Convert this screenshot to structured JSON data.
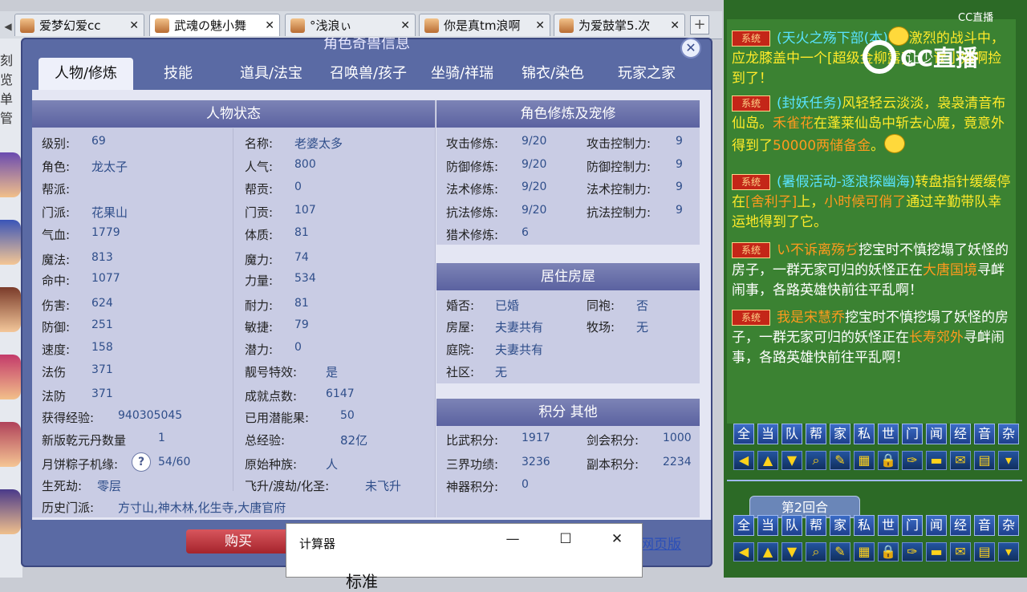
{
  "browser": {
    "tabs": [
      {
        "label": "爱梦幻爱cc",
        "active": false
      },
      {
        "label": "武魂の魅小舞",
        "active": true
      },
      {
        "label": "°浅浪ぃ",
        "active": false
      },
      {
        "label": "你是真tm浪啊",
        "active": false
      },
      {
        "label": "为爱鼓掌5.次",
        "active": false
      }
    ],
    "new_tab": "+",
    "close_glyph": "✕",
    "left_strip_text": [
      "刻览",
      "单管"
    ]
  },
  "game_window": {
    "title": "角色奇兽信息",
    "close": "✕",
    "tabs": [
      "人物/修炼",
      "技能",
      "道具/法宝",
      "召唤兽/孩子",
      "坐骑/祥瑞",
      "锦衣/染色",
      "玩家之家"
    ],
    "active_tab": "人物/修炼",
    "status": {
      "header": "人物状态",
      "left": [
        {
          "label": "级别:",
          "value": "69"
        },
        {
          "label": "角色:",
          "value": "龙太子"
        },
        {
          "label": "帮派:",
          "value": ""
        },
        {
          "label": "门派:",
          "value": "花果山"
        },
        {
          "label": "气血:",
          "value": "1779"
        },
        {
          "label": "魔法:",
          "value": "813"
        },
        {
          "label": "命中:",
          "value": "1077"
        },
        {
          "label": "伤害:",
          "value": "624"
        },
        {
          "label": "防御:",
          "value": "251"
        },
        {
          "label": "速度:",
          "value": "158"
        },
        {
          "label": "法伤",
          "value": "371"
        },
        {
          "label": "法防",
          "value": "371"
        }
      ],
      "right": [
        {
          "label": "名称:",
          "value": "老婆太多"
        },
        {
          "label": "人气:",
          "value": "800"
        },
        {
          "label": "帮贡:",
          "value": "0"
        },
        {
          "label": "门贡:",
          "value": "107"
        },
        {
          "label": "体质:",
          "value": "81"
        },
        {
          "label": "魔力:",
          "value": "74"
        },
        {
          "label": "力量:",
          "value": "534"
        },
        {
          "label": "耐力:",
          "value": "81"
        },
        {
          "label": "敏捷:",
          "value": "79"
        },
        {
          "label": "潜力:",
          "value": "0"
        },
        {
          "label": "靓号特效:",
          "value": "是"
        },
        {
          "label": "成就点数:",
          "value": "6147"
        }
      ],
      "extra_left": [
        {
          "label": "获得经验:",
          "value": "940305045"
        },
        {
          "label": "新版乾元丹数量",
          "value": "1"
        },
        {
          "label": "月饼粽子机缘:",
          "value": "54/60"
        },
        {
          "label": "生死劫:",
          "value": "零层"
        }
      ],
      "extra_right": [
        {
          "label": "已用潜能果:",
          "value": "50"
        },
        {
          "label": "总经验:",
          "value": "82亿"
        },
        {
          "label": "原始种族:",
          "value": "人"
        },
        {
          "label": "飞升/渡劫/化圣:",
          "value": "未飞升"
        }
      ],
      "history": {
        "label": "历史门派:",
        "value": "方寸山,神木林,化生寺,大唐官府"
      },
      "help_icon": "?"
    },
    "cultivation": {
      "header": "角色修炼及宠修",
      "left": [
        {
          "label": "攻击修炼:",
          "value": "9/20"
        },
        {
          "label": "防御修炼:",
          "value": "9/20"
        },
        {
          "label": "法术修炼:",
          "value": "9/20"
        },
        {
          "label": "抗法修炼:",
          "value": "9/20"
        },
        {
          "label": "猎术修炼:",
          "value": "6"
        }
      ],
      "right": [
        {
          "label": "攻击控制力:",
          "value": "9"
        },
        {
          "label": "防御控制力:",
          "value": "9"
        },
        {
          "label": "法术控制力:",
          "value": "9"
        },
        {
          "label": "抗法控制力:",
          "value": "9"
        }
      ]
    },
    "house": {
      "header": "居住房屋",
      "rows": [
        {
          "label": "婚否:",
          "value": "已婚"
        },
        {
          "label": "房屋:",
          "value": "夫妻共有"
        },
        {
          "label": "庭院:",
          "value": "夫妻共有"
        },
        {
          "label": "社区:",
          "value": "无"
        }
      ],
      "right": [
        {
          "label": "同袍:",
          "value": "否"
        },
        {
          "label": "牧场:",
          "value": "无"
        }
      ]
    },
    "points": {
      "header": "积分 其他",
      "left": [
        {
          "label": "比武积分:",
          "value": "1917"
        },
        {
          "label": "三界功绩:",
          "value": "3236"
        },
        {
          "label": "神器积分:",
          "value": "0"
        }
      ],
      "right": [
        {
          "label": "剑会积分:",
          "value": "1000"
        },
        {
          "label": "副本积分:",
          "value": "2234"
        }
      ]
    },
    "buy_button": "购买",
    "web_link": "网页版"
  },
  "calculator": {
    "title": "计算器",
    "minimize": "—",
    "maximize": "☐",
    "close": "✕",
    "mode": "标准"
  },
  "chat": {
    "watermark_logo": "CC直播",
    "watermark": "CC直播",
    "system_tag": "系统",
    "messages": [
      {
        "parts": [
          {
            "t": "(天火之殇下部(本)",
            "c": "g"
          },
          {
            "t": "激烈的战斗中，应龙膝盖中",
            "c": "y"
          },
          {
            "t": "一个",
            "c": "y"
          },
          {
            "t": "[超级金柳露]",
            "c": "y"
          },
          {
            "t": "让少",
            "c": "w"
          },
          {
            "t": "误小娟啊捡到了！",
            "c": "y"
          }
        ]
      },
      {
        "parts": [
          {
            "t": "(封妖任务)",
            "c": "g"
          },
          {
            "t": "风轻轻云淡淡，袅袅清音布仙岛。",
            "c": "y"
          },
          {
            "t": "禾雀花",
            "c": "o"
          },
          {
            "t": "在蓬莱仙岛中斩去心魔，竟意外得到了",
            "c": "y"
          },
          {
            "t": "50000两储备金",
            "c": "o"
          },
          {
            "t": "。",
            "c": "y"
          }
        ]
      },
      {
        "parts": [
          {
            "t": "(暑假活动-逐浪探幽海)",
            "c": "g"
          },
          {
            "t": "转盘指针缓缓停在",
            "c": "y"
          },
          {
            "t": "[舍利子]",
            "c": "o"
          },
          {
            "t": "上，",
            "c": "y"
          },
          {
            "t": "小时候可俏了",
            "c": "o"
          },
          {
            "t": "通过辛勤带队幸运地得到了它。",
            "c": "y"
          }
        ]
      },
      {
        "parts": [
          {
            "t": "い不诉离殇ぢ",
            "c": "o"
          },
          {
            "t": "挖宝时不慎挖塌了妖怪的房子，一群无家可归的妖怪正在",
            "c": "w"
          },
          {
            "t": "大唐国境",
            "c": "o"
          },
          {
            "t": "寻衅闹事，各路英雄快前往平乱啊！",
            "c": "w"
          }
        ]
      },
      {
        "parts": [
          {
            "t": "我是宋慧乔",
            "c": "o"
          },
          {
            "t": "挖宝时不慎挖塌了妖怪的房子，一群无家可归的妖怪正在",
            "c": "w"
          },
          {
            "t": "长寿郊外",
            "c": "o"
          },
          {
            "t": "寻衅闹事，各路英雄快前往平乱啊！",
            "c": "w"
          }
        ]
      }
    ],
    "channels": [
      "全",
      "当",
      "队",
      "帮",
      "家",
      "私",
      "世",
      "门",
      "闻",
      "经",
      "音",
      "杂"
    ],
    "tools": [
      "◀",
      "▲",
      "▼",
      "⌕",
      "✎",
      "▦",
      "🔒",
      "✑",
      "▬",
      "✉",
      "▤",
      "▾"
    ],
    "round_label": "第2回合"
  },
  "colors": {
    "panel_header": "#6a70aa",
    "value_blue": "#2f4e8a",
    "chat_bg": "#3b8232",
    "system_red": "#c42618"
  }
}
